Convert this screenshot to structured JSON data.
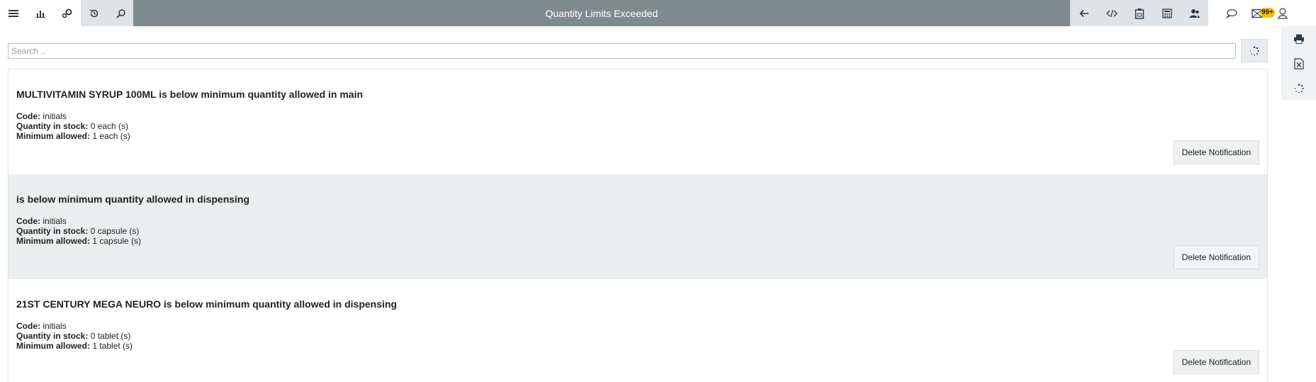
{
  "header": {
    "title": "Quantity Limits Exceeded",
    "mail_badge": "99+"
  },
  "left_toolbar": [
    "menu-icon",
    "bar-chart-icon",
    "settings-gears-icon",
    "history-icon",
    "search-icon"
  ],
  "right_toolbar": [
    "back-arrow-icon",
    "code-icon",
    "clipboard-icon",
    "calculator-icon",
    "users-icon"
  ],
  "user_toolbar": [
    "chat-icon",
    "mail-icon",
    "user-icon"
  ],
  "side_panel": [
    "print-icon",
    "excel-export-icon",
    "spinner-icon"
  ],
  "search": {
    "placeholder": "Search .."
  },
  "labels": {
    "code": "Code:",
    "quantity_in_stock": "Quantity in stock:",
    "minimum_allowed": "Minimum allowed:",
    "delete_button": "Delete Notification"
  },
  "notifications": [
    {
      "title": "MULTIVITAMIN SYRUP 100ML is below minimum quantity allowed in main",
      "code": "initials",
      "quantity_in_stock": "0 each (s)",
      "minimum_allowed": "1 each (s)"
    },
    {
      "title": "is below minimum quantity allowed in dispensing",
      "code": "initials",
      "quantity_in_stock": "0 capsule (s)",
      "minimum_allowed": "1 capsule (s)"
    },
    {
      "title": "21ST CENTURY MEGA NEURO is below minimum quantity allowed in dispensing",
      "code": "initials",
      "quantity_in_stock": "0 tablet (s)",
      "minimum_allowed": "1 tablet (s)"
    }
  ]
}
